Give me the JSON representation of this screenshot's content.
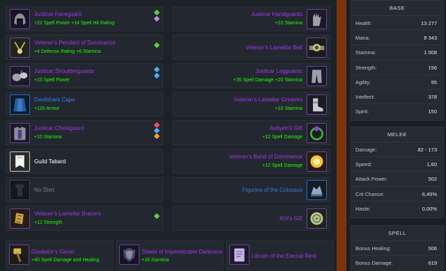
{
  "gear": {
    "left": [
      {
        "name": "Justicar Faceguard",
        "stats": "+22 Spell Power +14 Spell Hit Rating",
        "quality": "epic",
        "icon": "helmet-icon",
        "gems": [
          "green",
          "purple"
        ]
      },
      {
        "name": "Veteran's Pendant of Dominance",
        "stats": "+4 Defense Rating +6 Stamina",
        "quality": "epic",
        "icon": "pendant-icon",
        "gems": [
          "green"
        ]
      },
      {
        "name": "Justicar Shoulderguards",
        "stats": "+15 Spell Power",
        "quality": "epic",
        "icon": "shoulder-icon",
        "gems": [
          "blue",
          "blue"
        ]
      },
      {
        "name": "Devilshark Cape",
        "stats": "+120 Armor",
        "quality": "rare",
        "icon": "cape-icon",
        "gems": []
      },
      {
        "name": "Justicar Chestguard",
        "stats": "+10 Stamina",
        "quality": "epic",
        "icon": "chest-icon",
        "gems": [
          "red",
          "blue",
          "orange"
        ]
      },
      {
        "name": "Guild Tabard",
        "stats": "",
        "quality": "common",
        "icon": "tabard-icon",
        "gems": []
      },
      {
        "name": "No Shirt",
        "stats": "",
        "quality": "poor",
        "icon": "shirt-icon",
        "gems": []
      },
      {
        "name": "Veteran's Lamellar Bracers",
        "stats": "+12 Strength",
        "quality": "epic",
        "icon": "bracers-icon",
        "gems": [
          "green"
        ]
      }
    ],
    "right": [
      {
        "name": "Justicar Handguards",
        "stats": "+10 Stamina",
        "quality": "epic",
        "icon": "gloves-icon"
      },
      {
        "name": "Veteran's Lamellar Belt",
        "stats": "",
        "quality": "epic",
        "icon": "belt-icon"
      },
      {
        "name": "Justicar Legguards",
        "stats": "+35 Spell Damage +20 Stamina",
        "quality": "epic",
        "icon": "legs-icon"
      },
      {
        "name": "Veteran's Lamellar Greaves",
        "stats": "+10 Stamina",
        "quality": "epic",
        "icon": "boots-icon"
      },
      {
        "name": "Ashyen's Gift",
        "stats": "+12 Spell Damage",
        "quality": "epic",
        "icon": "ring-icon"
      },
      {
        "name": "Veteran's Band of Dominance",
        "stats": "+12 Spell Damage",
        "quality": "epic",
        "icon": "ring-icon"
      },
      {
        "name": "Figurine of the Colossus",
        "stats": "",
        "quality": "rare",
        "icon": "figurine-icon"
      },
      {
        "name": "Xi'ri's Gift",
        "stats": "",
        "quality": "epic",
        "icon": "trinket-icon"
      }
    ],
    "weapons": [
      {
        "name": "Gladiator's Gavel",
        "stats": "+40 Spell Damage and Healing",
        "quality": "epic",
        "icon": "mace-icon"
      },
      {
        "name": "Shield of Impenetrable Darkness",
        "stats": "+18 Stamina",
        "quality": "epic",
        "icon": "shield-icon"
      },
      {
        "name": "Libram of the Eternal Rest",
        "stats": "",
        "quality": "epic",
        "icon": "libram-icon"
      }
    ]
  },
  "panels": {
    "base": {
      "title": "BASE",
      "rows": [
        {
          "label": "Health:",
          "value": "13 277"
        },
        {
          "label": "Mana:",
          "value": "8 343"
        },
        {
          "label": "Stamina:",
          "value": "1 008"
        },
        {
          "label": "Strength:",
          "value": "156"
        },
        {
          "label": "Agility:",
          "value": "95"
        },
        {
          "label": "Intellect:",
          "value": "378"
        },
        {
          "label": "Spirit:",
          "value": "150"
        }
      ]
    },
    "melee": {
      "title": "MELEE",
      "rows": [
        {
          "label": "Damage:",
          "value": "82 - 173"
        },
        {
          "label": "Speed:",
          "value": "1,60"
        },
        {
          "label": "Attack Power:",
          "value": "502"
        },
        {
          "label": "Crit Chance:",
          "value": "6,45%"
        },
        {
          "label": "Haste:",
          "value": "0,00%"
        }
      ]
    },
    "spell": {
      "title": "SPELL",
      "rows": [
        {
          "label": "Bonus Healing:",
          "value": "506"
        },
        {
          "label": "Bonus Damage:",
          "value": "619"
        }
      ]
    }
  },
  "colors": {
    "epic": "#a335ee",
    "rare": "#2f7fe0",
    "common": "#ffffff",
    "poor": "#7a7d82",
    "stat_green": "#1eff00",
    "divider": "#7a3410"
  }
}
